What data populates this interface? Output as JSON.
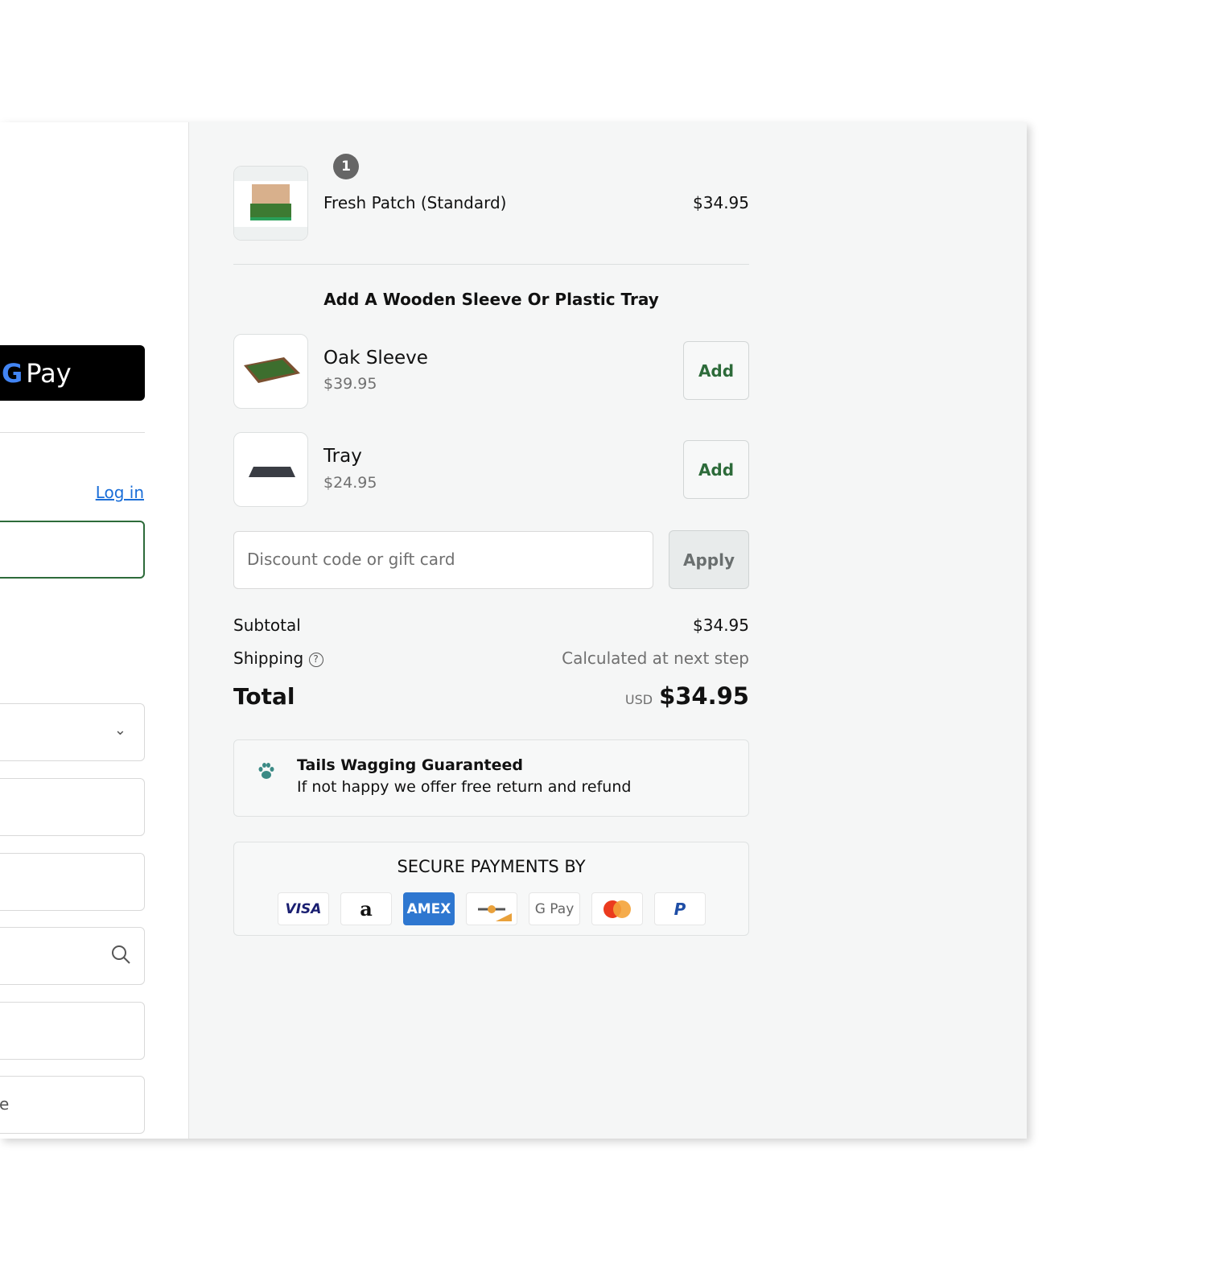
{
  "left": {
    "gpay_label": "Pay",
    "gpay_g": "G",
    "login_link": "Log in",
    "partial_field_text": "e"
  },
  "cart": {
    "item": {
      "name": "Fresh Patch (Standard)",
      "price": "$34.95",
      "quantity": "1"
    },
    "upsell_title": "Add A Wooden Sleeve Or Plastic Tray",
    "upsells": [
      {
        "name": "Oak Sleeve",
        "price": "$39.95",
        "button": "Add"
      },
      {
        "name": "Tray",
        "price": "$24.95",
        "button": "Add"
      }
    ],
    "discount": {
      "placeholder": "Discount code or gift card",
      "apply": "Apply"
    },
    "subtotal_label": "Subtotal",
    "subtotal": "$34.95",
    "shipping_label": "Shipping",
    "shipping_value": "Calculated at next step",
    "total_label": "Total",
    "currency": "USD",
    "total": "$34.95"
  },
  "guarantee": {
    "title": "Tails Wagging Guaranteed",
    "text": "If not happy we offer free return and refund",
    "icon": "paw-icon",
    "icon_color": "#3b8a85"
  },
  "payments": {
    "title": "SECURE PAYMENTS BY",
    "methods": [
      "VISA",
      "a",
      "AMEX",
      "",
      "G Pay",
      "",
      ""
    ]
  },
  "colors": {
    "accent": "#2d6b3a",
    "link": "#1a6ed8",
    "amex": "#2e77d0"
  }
}
